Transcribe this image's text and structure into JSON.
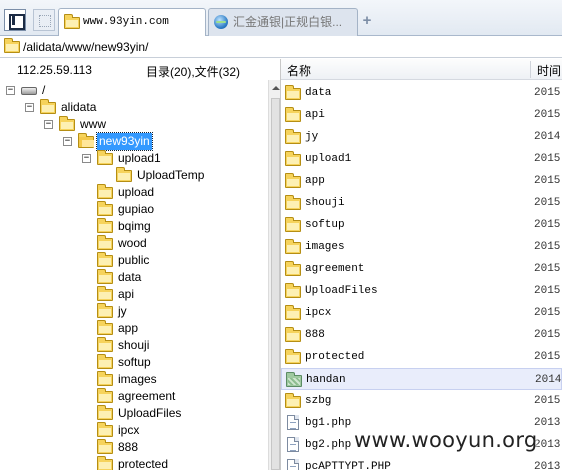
{
  "tabs": [
    {
      "label": "www.93yin.com",
      "active": true
    },
    {
      "label": "汇金通银|正规白银...",
      "active": false
    }
  ],
  "new_tab_symbol": "+",
  "address": {
    "path": "/alidata/www/new93yin/"
  },
  "left_header": {
    "ip": "112.25.59.113",
    "counts": "目录(20),文件(32)"
  },
  "tree": [
    {
      "label": "/",
      "toggle": "−",
      "icon": "drive-icon"
    },
    {
      "label": "alidata",
      "toggle": "−",
      "icon": "folder-icon"
    },
    {
      "label": "www",
      "toggle": "−",
      "icon": "folder-icon"
    },
    {
      "label": "new93yin",
      "toggle": "−",
      "icon": "folder-open-icon",
      "selected": true
    },
    {
      "label": "upload1",
      "toggle": "−",
      "icon": "folder-icon"
    },
    {
      "label": "UploadTemp",
      "icon": "folder-icon"
    },
    {
      "label": "upload",
      "icon": "folder-icon"
    },
    {
      "label": "gupiao",
      "icon": "folder-icon"
    },
    {
      "label": "bqimg",
      "icon": "folder-icon"
    },
    {
      "label": "wood",
      "icon": "folder-icon"
    },
    {
      "label": "public",
      "icon": "folder-icon"
    },
    {
      "label": "data",
      "icon": "folder-icon"
    },
    {
      "label": "api",
      "icon": "folder-icon"
    },
    {
      "label": "jy",
      "icon": "folder-icon"
    },
    {
      "label": "app",
      "icon": "folder-icon"
    },
    {
      "label": "shouji",
      "icon": "folder-icon"
    },
    {
      "label": "softup",
      "icon": "folder-icon"
    },
    {
      "label": "images",
      "icon": "folder-icon"
    },
    {
      "label": "agreement",
      "icon": "folder-icon"
    },
    {
      "label": "UploadFiles",
      "icon": "folder-icon"
    },
    {
      "label": "ipcx",
      "icon": "folder-icon"
    },
    {
      "label": "888",
      "icon": "folder-icon"
    },
    {
      "label": "protected",
      "icon": "folder-icon"
    }
  ],
  "columns": {
    "name": "名称",
    "time": "时间"
  },
  "files": [
    {
      "name": "data",
      "time": "2015-",
      "icon": "folder-icon"
    },
    {
      "name": "api",
      "time": "2015-",
      "icon": "folder-icon"
    },
    {
      "name": "jy",
      "time": "2014-",
      "icon": "folder-icon"
    },
    {
      "name": "upload1",
      "time": "2015-",
      "icon": "folder-icon"
    },
    {
      "name": "app",
      "time": "2015-",
      "icon": "folder-icon"
    },
    {
      "name": "shouji",
      "time": "2015-",
      "icon": "folder-icon"
    },
    {
      "name": "softup",
      "time": "2015-",
      "icon": "folder-icon"
    },
    {
      "name": "images",
      "time": "2015-",
      "icon": "folder-icon"
    },
    {
      "name": "agreement",
      "time": "2015-",
      "icon": "folder-icon"
    },
    {
      "name": "UploadFiles",
      "time": "2015-",
      "icon": "folder-icon"
    },
    {
      "name": "ipcx",
      "time": "2015-",
      "icon": "folder-icon"
    },
    {
      "name": "888",
      "time": "2015-",
      "icon": "folder-icon"
    },
    {
      "name": "protected",
      "time": "2015-",
      "icon": "folder-icon"
    },
    {
      "name": "handan",
      "time": "2014-",
      "icon": "folder-hatched-icon",
      "highlighted": true
    },
    {
      "name": "szbg",
      "time": "2015-",
      "icon": "folder-icon"
    },
    {
      "name": "bg1.php",
      "time": "2013-",
      "icon": "file-icon"
    },
    {
      "name": "bg2.php",
      "time": "2013-",
      "icon": "file-icon"
    },
    {
      "name": "pcAPTTYPT.PHP",
      "time": "2013-",
      "icon": "file-icon"
    }
  ],
  "watermark": "www.wooyun.org"
}
